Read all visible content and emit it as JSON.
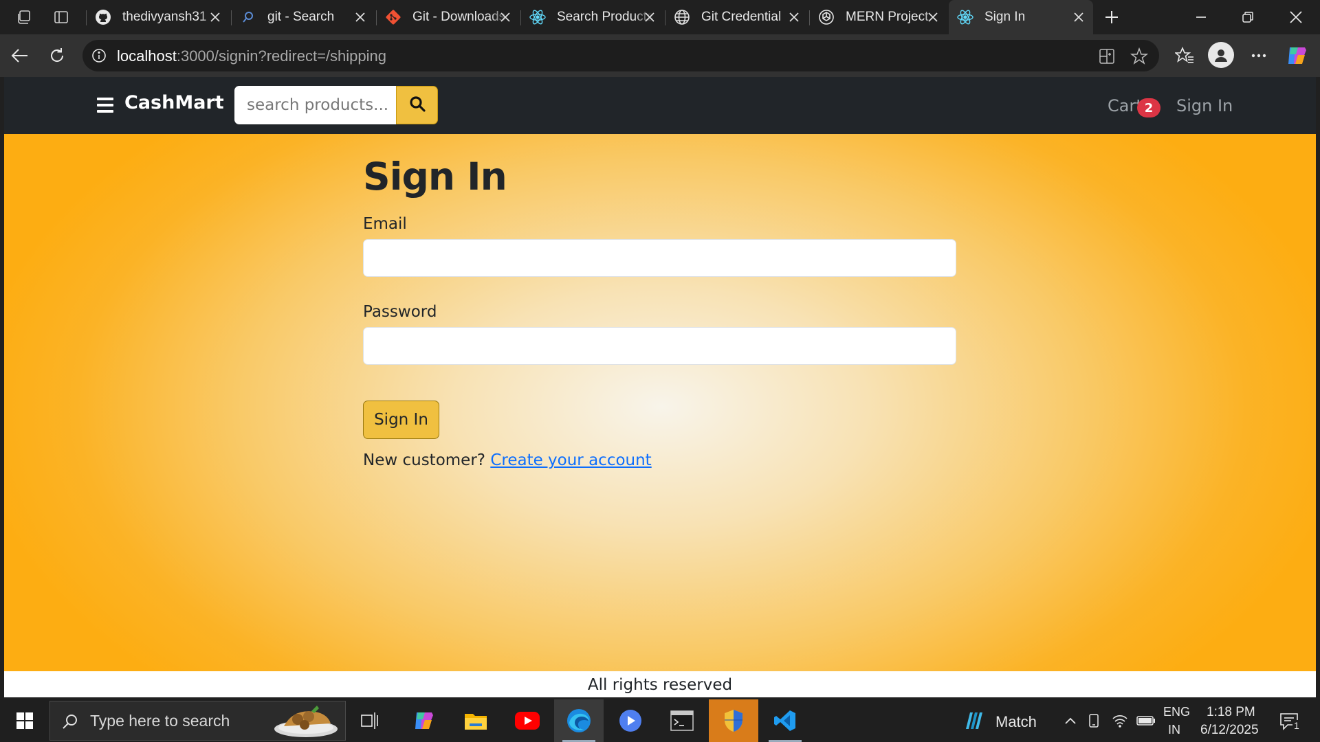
{
  "browser": {
    "tabs": [
      {
        "title": "thedivyansh31",
        "icon": "github-icon"
      },
      {
        "title": "git - Search",
        "icon": "bing-search-icon"
      },
      {
        "title": "Git - Downloads",
        "icon": "git-logo-icon"
      },
      {
        "title": "Search Products",
        "icon": "react-icon"
      },
      {
        "title": "Git Credential",
        "icon": "globe-icon"
      },
      {
        "title": "MERN Project",
        "icon": "openai-icon"
      },
      {
        "title": "Sign In",
        "icon": "react-icon",
        "active": true
      }
    ],
    "url_host": "localhost",
    "url_rest": ":3000/signin?redirect=/shipping"
  },
  "navbar": {
    "brand": "CashMart",
    "search_placeholder": "search products...",
    "cart_label": "Cart",
    "cart_count": "2",
    "signin_label": "Sign In"
  },
  "form": {
    "title": "Sign In",
    "email_label": "Email",
    "email_value": "",
    "password_label": "Password",
    "password_value": "",
    "submit_label": "Sign In",
    "new_customer_text": "New customer?",
    "create_account_link": "Create your account"
  },
  "footer": {
    "text": "All rights reserved"
  },
  "taskbar": {
    "search_placeholder": "Type here to search",
    "widget_label": "Match",
    "lang_top": "ENG",
    "lang_bottom": "IN",
    "time": "1:18 PM",
    "date": "6/12/2025",
    "notification_count": "1"
  },
  "colors": {
    "navbar_bg": "#212529",
    "accent_yellow": "#f0c040",
    "badge_red": "#dc3545",
    "link_blue": "#0d6efd",
    "page_bg_orange": "#fdad12"
  }
}
